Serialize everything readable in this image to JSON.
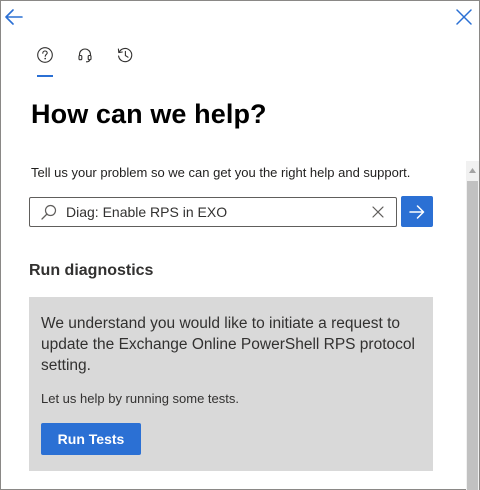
{
  "header": {
    "back_icon": "arrow-left-icon",
    "close_icon": "close-icon",
    "tabs": [
      {
        "icon": "help-question-icon",
        "active": true
      },
      {
        "icon": "headset-icon",
        "active": false
      },
      {
        "icon": "history-clock-icon",
        "active": false
      }
    ]
  },
  "main": {
    "title": "How can we help?",
    "description": "Tell us your problem so we can get you the right help and support.",
    "search": {
      "value": "Diag: Enable RPS in EXO",
      "placeholder": ""
    }
  },
  "diagnostics": {
    "section_title": "Run diagnostics",
    "message": "We understand you would like to initiate a request to update the Exchange Online PowerShell RPS protocol setting.",
    "subtext": "Let us help by running some tests.",
    "button_label": "Run Tests"
  },
  "colors": {
    "accent": "#2b70d4",
    "card_background": "#d9d9d9"
  }
}
